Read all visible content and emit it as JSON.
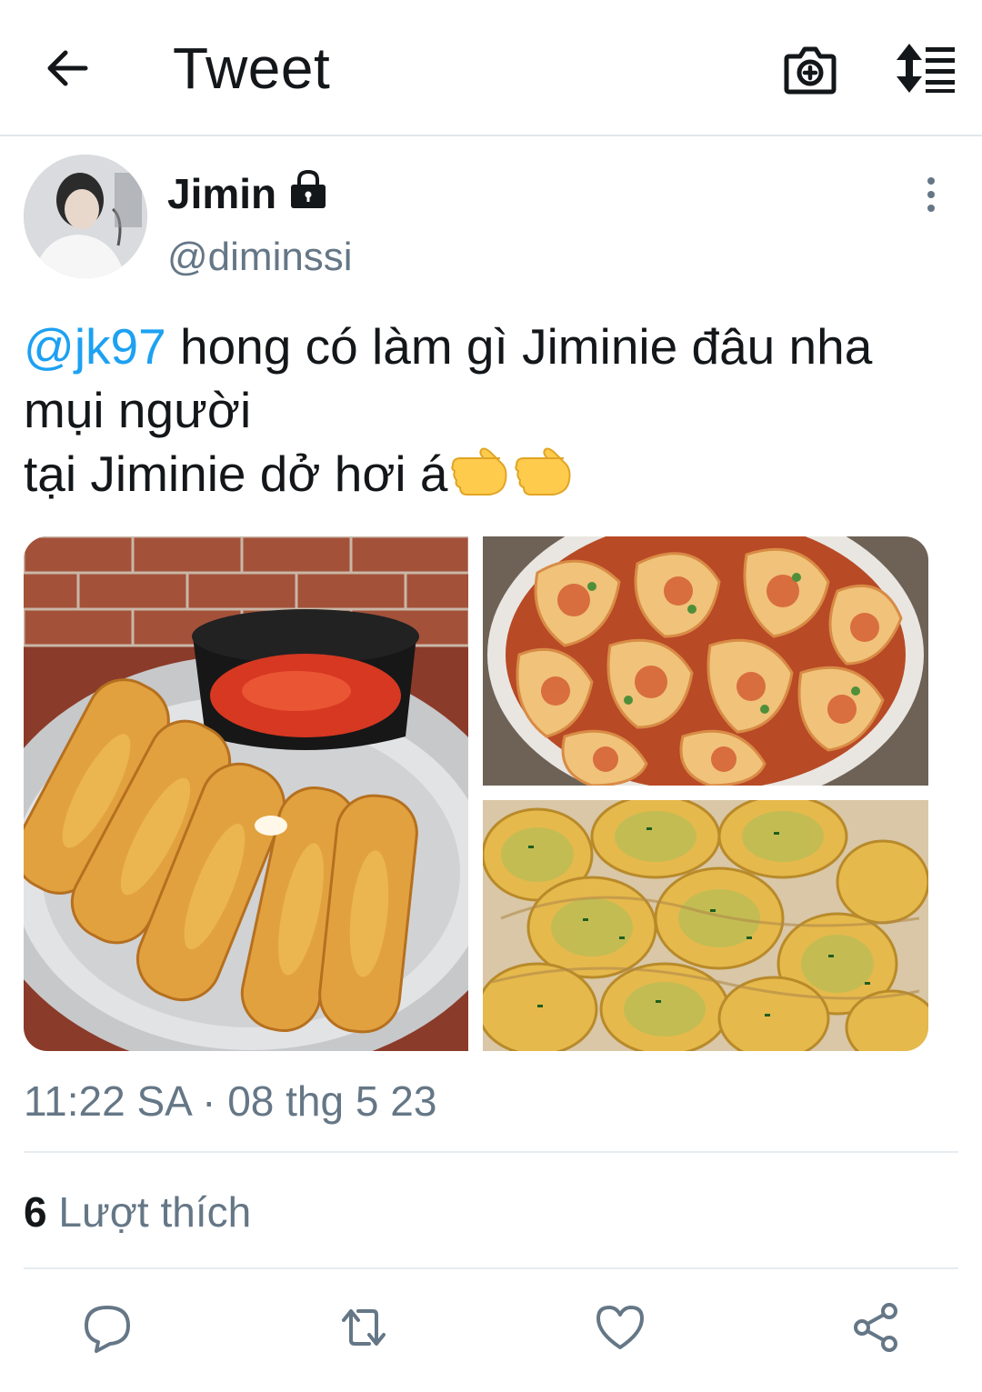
{
  "header": {
    "title": "Tweet",
    "icons": [
      "back-arrow-icon",
      "camera-plus-icon",
      "sort-lines-icon"
    ]
  },
  "author": {
    "name": "Jimin",
    "handle": "@diminssi",
    "protected_icon": "lock-icon"
  },
  "tweet": {
    "mention": "@jk97",
    "line1_rest": " hong có làm gì Jiminie đâu nha",
    "line2": "mụi người",
    "line3": "tại Jiminie dở hơi á",
    "emojis": [
      "pointing-right-emoji",
      "pointing-right-emoji"
    ],
    "images": [
      "mozzarella-sticks-photo",
      "wontons-chili-oil-photo",
      "crinkle-cut-potatoes-photo"
    ]
  },
  "meta": {
    "time": "11:22 SA",
    "separator": "·",
    "date": "08 thg 5 23"
  },
  "stats": {
    "likes_count": "6",
    "likes_label": "Lượt thích"
  },
  "actions": [
    "reply-icon",
    "retweet-icon",
    "like-icon",
    "share-icon"
  ],
  "colors": {
    "accent": "#1da1f2",
    "secondary_text": "#657786",
    "divider": "#e6ecf0"
  }
}
